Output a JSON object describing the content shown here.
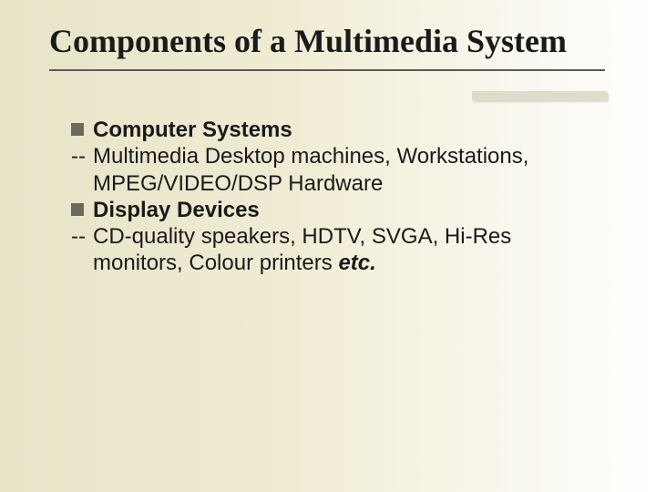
{
  "title": "Components of a Multimedia System",
  "items": {
    "h1": "Computer Systems",
    "d1_dash": "--",
    "d1_text": "Multimedia Desktop machines, Workstations, MPEG/VIDEO/DSP Hardware",
    "h2": "Display Devices",
    "d2_dash": "--",
    "d2_text_pre": "CD-quality speakers, HDTV, SVGA, Hi-Res monitors, Colour printers ",
    "d2_text_em": "etc."
  }
}
